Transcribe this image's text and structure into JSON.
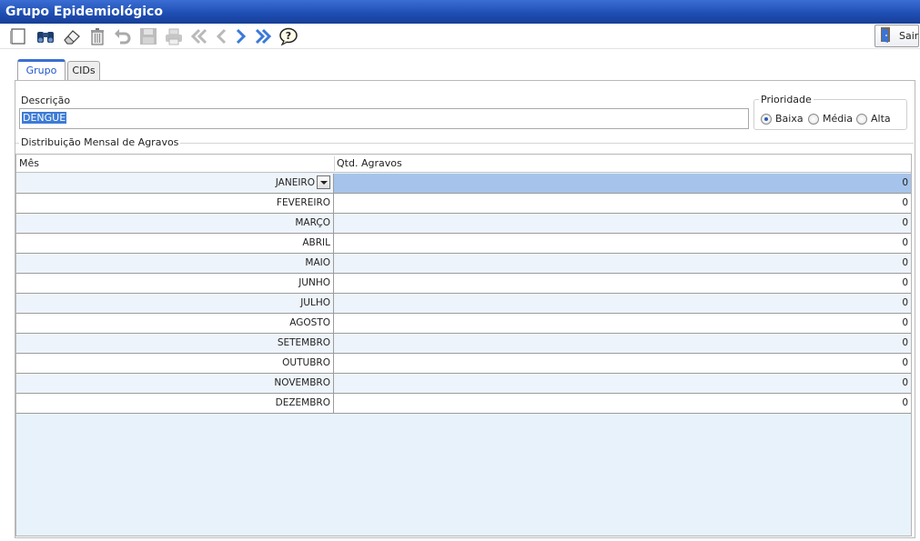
{
  "window": {
    "title": "Grupo Epidemiológico"
  },
  "toolbar": {
    "buttons": [
      {
        "icon": "new-icon"
      },
      {
        "icon": "search-binoculars-icon"
      },
      {
        "icon": "eraser-icon"
      },
      {
        "icon": "trash-icon"
      },
      {
        "icon": "undo-icon"
      },
      {
        "icon": "save-icon"
      },
      {
        "icon": "print-icon"
      },
      {
        "icon": "first-record-icon"
      },
      {
        "icon": "previous-record-icon"
      },
      {
        "icon": "next-record-icon"
      },
      {
        "icon": "last-record-icon"
      },
      {
        "icon": "help-icon"
      }
    ],
    "exit_label": "Sair"
  },
  "tabs": [
    {
      "label": "Grupo",
      "active": true
    },
    {
      "label": "CIDs",
      "active": false
    }
  ],
  "form": {
    "descricao_label": "Descrição",
    "descricao_value": "DENGUE",
    "prioridade_label": "Prioridade",
    "prioridade_options": [
      {
        "label": "Baixa",
        "selected": true
      },
      {
        "label": "Média",
        "selected": false
      },
      {
        "label": "Alta",
        "selected": false
      }
    ]
  },
  "distribution": {
    "legend": "Distribuição Mensal de Agravos",
    "columns": [
      "Mês",
      "Qtd. Agravos"
    ],
    "rows": [
      {
        "mes": "JANEIRO",
        "qtd": "0"
      },
      {
        "mes": "FEVEREIRO",
        "qtd": "0"
      },
      {
        "mes": "MARÇO",
        "qtd": "0"
      },
      {
        "mes": "ABRIL",
        "qtd": "0"
      },
      {
        "mes": "MAIO",
        "qtd": "0"
      },
      {
        "mes": "JUNHO",
        "qtd": "0"
      },
      {
        "mes": "JULHO",
        "qtd": "0"
      },
      {
        "mes": "AGOSTO",
        "qtd": "0"
      },
      {
        "mes": "SETEMBRO",
        "qtd": "0"
      },
      {
        "mes": "OUTUBRO",
        "qtd": "0"
      },
      {
        "mes": "NOVEMBRO",
        "qtd": "0"
      },
      {
        "mes": "DEZEMBRO",
        "qtd": "0"
      }
    ]
  },
  "colors": {
    "title_bar": "#1f4fb4",
    "selected_cell": "#a6c4eb",
    "selected_text": "#3d7bd6",
    "grid_background": "#e8f2fa"
  }
}
